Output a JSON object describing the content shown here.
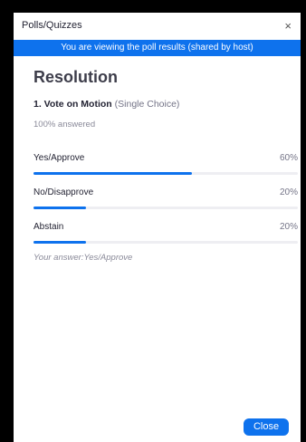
{
  "window": {
    "title": "Polls/Quizzes",
    "close_glyph": "×"
  },
  "banner": {
    "text": "You are viewing the poll results (shared by host)"
  },
  "poll": {
    "title": "Resolution",
    "question": {
      "number_title": "1. Vote on Motion",
      "type": "(Single Choice)"
    },
    "answered": "100% answered",
    "options": [
      {
        "label": "Yes/Approve",
        "percent_text": "60%",
        "fraction": 0.6
      },
      {
        "label": "No/Disapprove",
        "percent_text": "20%",
        "fraction": 0.2
      },
      {
        "label": "Abstain",
        "percent_text": "20%",
        "fraction": 0.2
      }
    ],
    "your_answer": "Your answer:Yes/Approve"
  },
  "footer": {
    "close_label": "Close"
  },
  "colors": {
    "accent": "#0e72ed",
    "track": "#eeeef2"
  }
}
